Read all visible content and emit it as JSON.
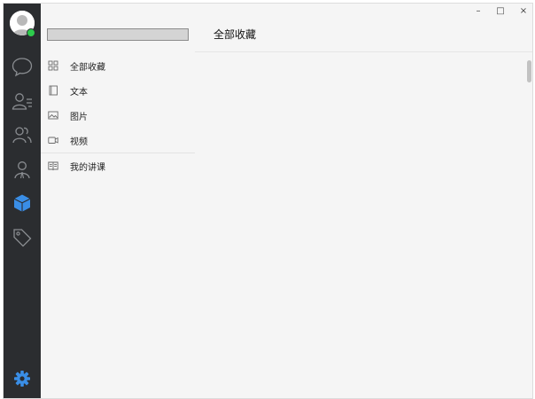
{
  "main": {
    "title": "全部收藏"
  },
  "sidebar": {
    "search": {
      "value": "",
      "placeholder": ""
    },
    "items": [
      {
        "label": "全部收藏",
        "icon": "grid-icon"
      },
      {
        "label": "文本",
        "icon": "document-icon"
      },
      {
        "label": "图片",
        "icon": "image-icon"
      },
      {
        "label": "视频",
        "icon": "video-icon"
      },
      {
        "label": "我的讲课",
        "icon": "book-icon"
      }
    ]
  },
  "iconbar": {
    "icons": [
      "chat-icon",
      "contacts-icon",
      "groups-icon",
      "user-icon",
      "cube-icon",
      "tag-icon"
    ],
    "bottom_icon": "settings-icon",
    "active_color": "#3a8ee6",
    "background": "#2b2d30"
  },
  "window_controls": {
    "minimize": "–",
    "maximize": "□",
    "close": "×"
  }
}
